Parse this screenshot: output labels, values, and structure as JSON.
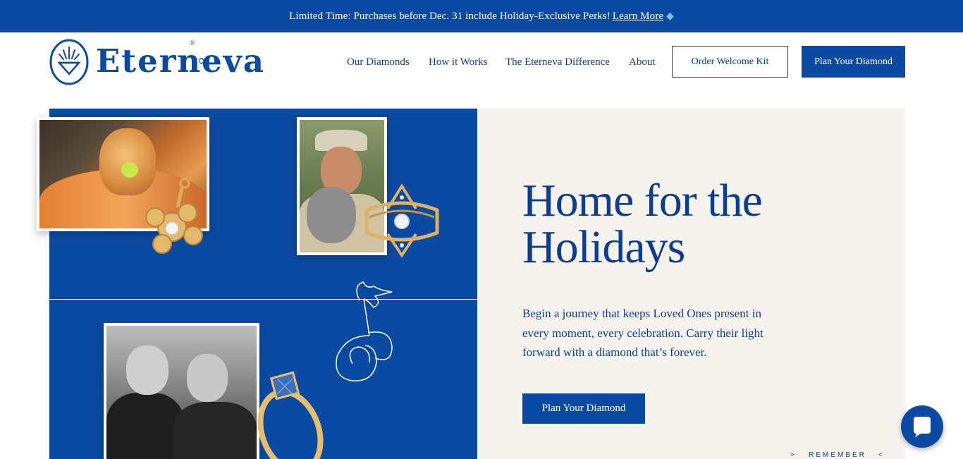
{
  "announcement": {
    "text": "Limited Time:  Purchases before Dec. 31 include Holiday-Exclusive Perks!",
    "link_label": "Learn More",
    "icon": "diamond-icon"
  },
  "header": {
    "brand": "Eterneva",
    "brand_mark": "®",
    "brand_suffix_icon": "infinity-icon",
    "nav": [
      {
        "label": "Our Diamonds"
      },
      {
        "label": "How it Works"
      },
      {
        "label": "The Eterneva Difference"
      },
      {
        "label": "About"
      }
    ],
    "order_kit_label": "Order Welcome Kit",
    "plan_label": "Plan Your Diamond"
  },
  "hero": {
    "headline_line1": "Home for the",
    "headline_line2": "Holidays",
    "body": "Begin a journey that keeps Loved Ones present in every moment, every celebration. Carry their light forward with a diamond that’s forever.",
    "cta_label": "Plan Your Diamond",
    "remember_label": "REMEMBER",
    "images": [
      "dog-photo",
      "koala-photo",
      "wedding-photo",
      "paw-pendant",
      "gold-ring-stack",
      "blue-diamond-ring",
      "palm-tree-line-art"
    ]
  },
  "colors": {
    "brand_blue": "#0b4aa2",
    "cream": "#f6f3ef",
    "white": "#ffffff"
  },
  "chat": {
    "icon": "chat-bubble-icon"
  }
}
